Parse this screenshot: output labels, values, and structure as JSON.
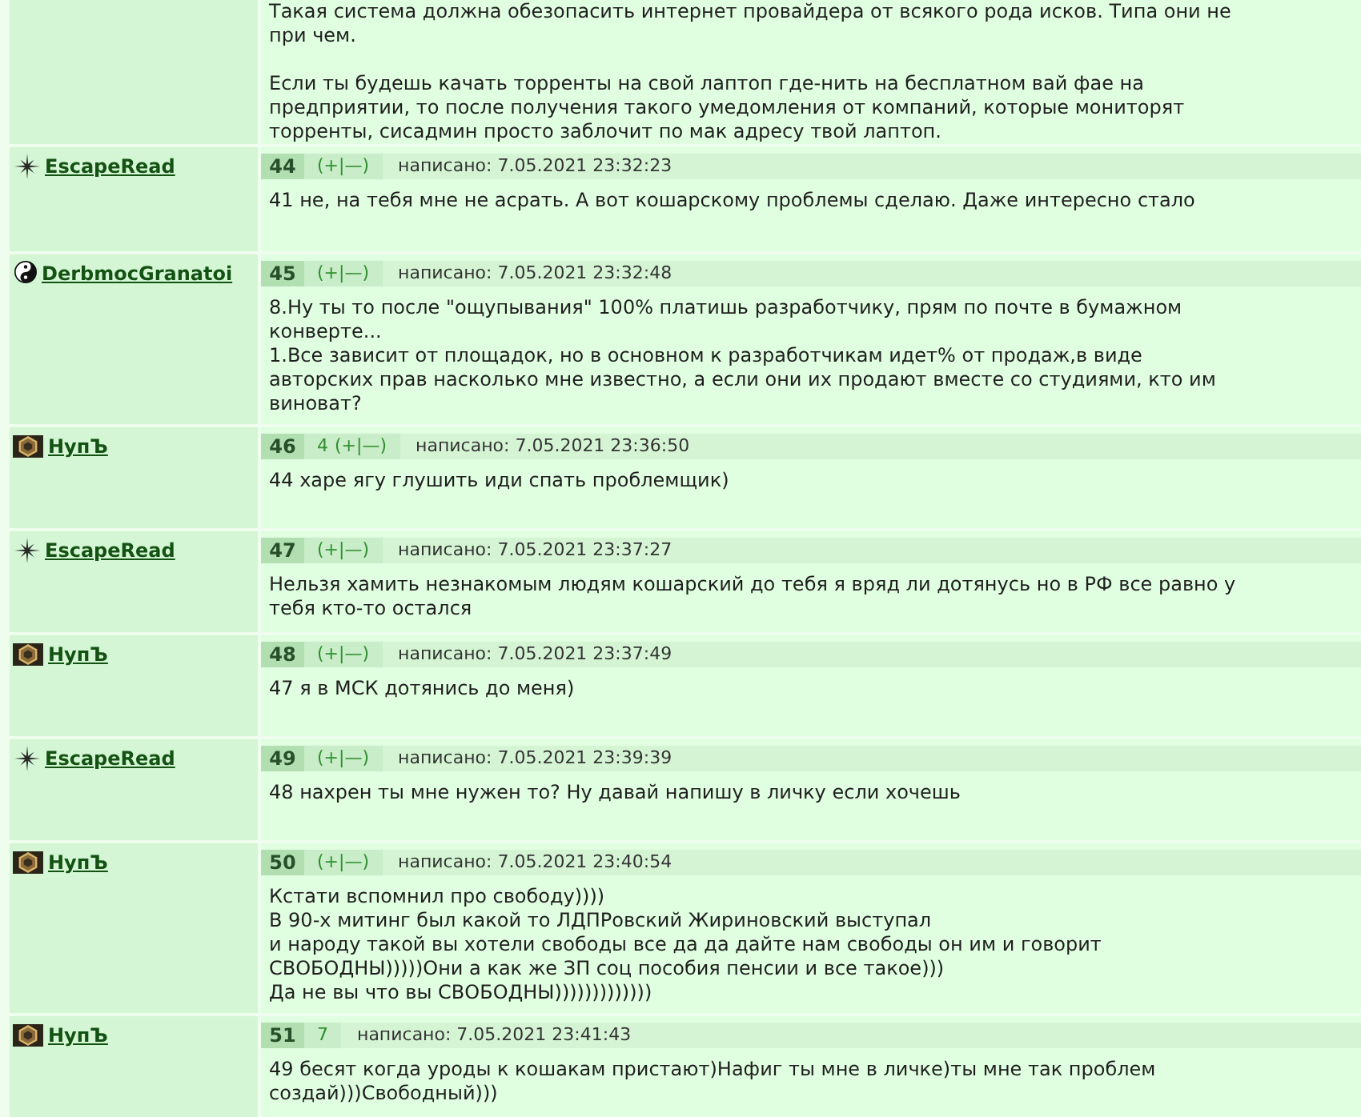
{
  "continued_post": {
    "text": "Такая система должна обезопасить интернет провайдера от всякого рода исков. Типа они не\nпри чем.\n\nЕсли ты будешь качать торренты на свой лаптоп где-нить на бесплатном вай фае на\nпредприятии, то после получения такого умедомления от компаний, которые мониторят\nторренты, сисадмин просто заблочит по мак адресу твой лаптоп."
  },
  "posts": [
    {
      "author": "EscapeRead",
      "avatar": {
        "kind": "star"
      },
      "number": "44",
      "vote": "(+|—)",
      "posted": "написано: 7.05.2021 23:32:23",
      "text": "41 не, на тебя мне не асрать. А вот кошарскому проблемы сделаю. Даже интересно стало"
    },
    {
      "author": "DerbmocGranatoi",
      "avatar": {
        "kind": "yinyang"
      },
      "number": "45",
      "vote": "(+|—)",
      "posted": "написано: 7.05.2021 23:32:48",
      "text": "8.Ну ты то после \"ощупывания\" 100% платишь разработчику, прям по почте в бумажном\nконверте...\n1.Все зависит от площадок, но в основном к разработчикам идет% от продаж,в виде\nавторских прав насколько мне известно, а если они их продают вместе со студиями, кто им\nвиноват?"
    },
    {
      "author": "НупЪ",
      "avatar": {
        "kind": "hexagon"
      },
      "number": "46",
      "score": "4",
      "vote": "(+|—)",
      "posted": "написано: 7.05.2021 23:36:50",
      "text": "44 харе ягу глушить иди спать проблемщик)"
    },
    {
      "author": "EscapeRead",
      "avatar": {
        "kind": "star"
      },
      "number": "47",
      "vote": "(+|—)",
      "posted": "написано: 7.05.2021 23:37:27",
      "text": "Нельзя хамить незнакомым людям кошарский до тебя я вряд ли дотянусь но в РФ все равно у\nтебя кто-то остался"
    },
    {
      "author": "НупЪ",
      "avatar": {
        "kind": "hexagon"
      },
      "number": "48",
      "vote": "(+|—)",
      "posted": "написано: 7.05.2021 23:37:49",
      "text": "47 я в МСК дотянись до меня)"
    },
    {
      "author": "EscapeRead",
      "avatar": {
        "kind": "star"
      },
      "number": "49",
      "vote": "(+|—)",
      "posted": "написано: 7.05.2021 23:39:39",
      "text": "48 нахрен ты мне нужен то? Ну давай напишу в личку если хочешь"
    },
    {
      "author": "НупЪ",
      "avatar": {
        "kind": "hexagon"
      },
      "number": "50",
      "vote": "(+|—)",
      "posted": "написано: 7.05.2021 23:40:54",
      "text": "Кстати вспомнил про свободу))))\nВ 90-х митинг был какой то ЛДПРовский Жириновский выступал\nи народу такой вы хотели свободы все да да дайте нам свободы он им и говорит\nСВОБОДНЫ)))))Они а как же ЗП соц пособия пенсии и все такое)))\nДа не вы что вы СВОБОДНЫ)))))))))))))"
    },
    {
      "author": "НупЪ",
      "avatar": {
        "kind": "hexagon"
      },
      "number": "51",
      "score": "7",
      "posted": "написано: 7.05.2021 23:41:43",
      "text": "49 бесят когда уроды к кошакам пристают)Нафиг ты мне в личке)ты мне так проблем\nсоздай)))Свободный)))"
    }
  ]
}
